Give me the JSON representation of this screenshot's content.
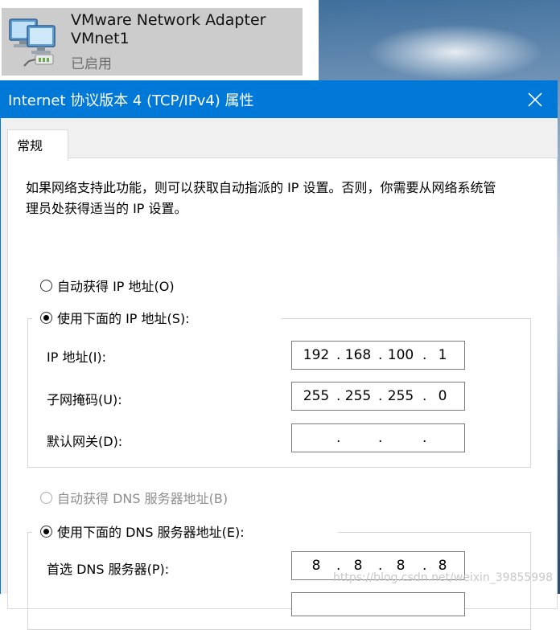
{
  "adapter": {
    "name": "VMware Network Adapter VMnet1",
    "status": "已启用"
  },
  "dialog": {
    "title": "Internet 协议版本 4 (TCP/IPv4) 属性",
    "tab_label": "常规",
    "description": "如果网络支持此功能，则可以获取自动指派的 IP 设置。否则，你需要从网络系统管理员处获得适当的 IP 设置。",
    "ip_section": {
      "auto_label": "自动获得 IP 地址(O)",
      "manual_label": "使用下面的 IP 地址(S):",
      "selected": "manual",
      "fields": [
        {
          "label": "IP 地址(I):",
          "octets": [
            "192",
            "168",
            "100",
            "1"
          ]
        },
        {
          "label": "子网掩码(U):",
          "octets": [
            "255",
            "255",
            "255",
            "0"
          ]
        },
        {
          "label": "默认网关(D):",
          "octets": [
            "",
            "",
            "",
            ""
          ]
        }
      ]
    },
    "dns_section": {
      "auto_label": "自动获得 DNS 服务器地址(B)",
      "manual_label": "使用下面的 DNS 服务器地址(E):",
      "selected": "manual",
      "fields": [
        {
          "label": "首选 DNS 服务器(P):",
          "octets": [
            "8",
            "8",
            "8",
            "8"
          ]
        }
      ]
    }
  },
  "watermark": "https://blog.csdn.net/weixin_39855998",
  "colors": {
    "title_bar": "#0078d7",
    "selected_item": "#cccccc"
  }
}
